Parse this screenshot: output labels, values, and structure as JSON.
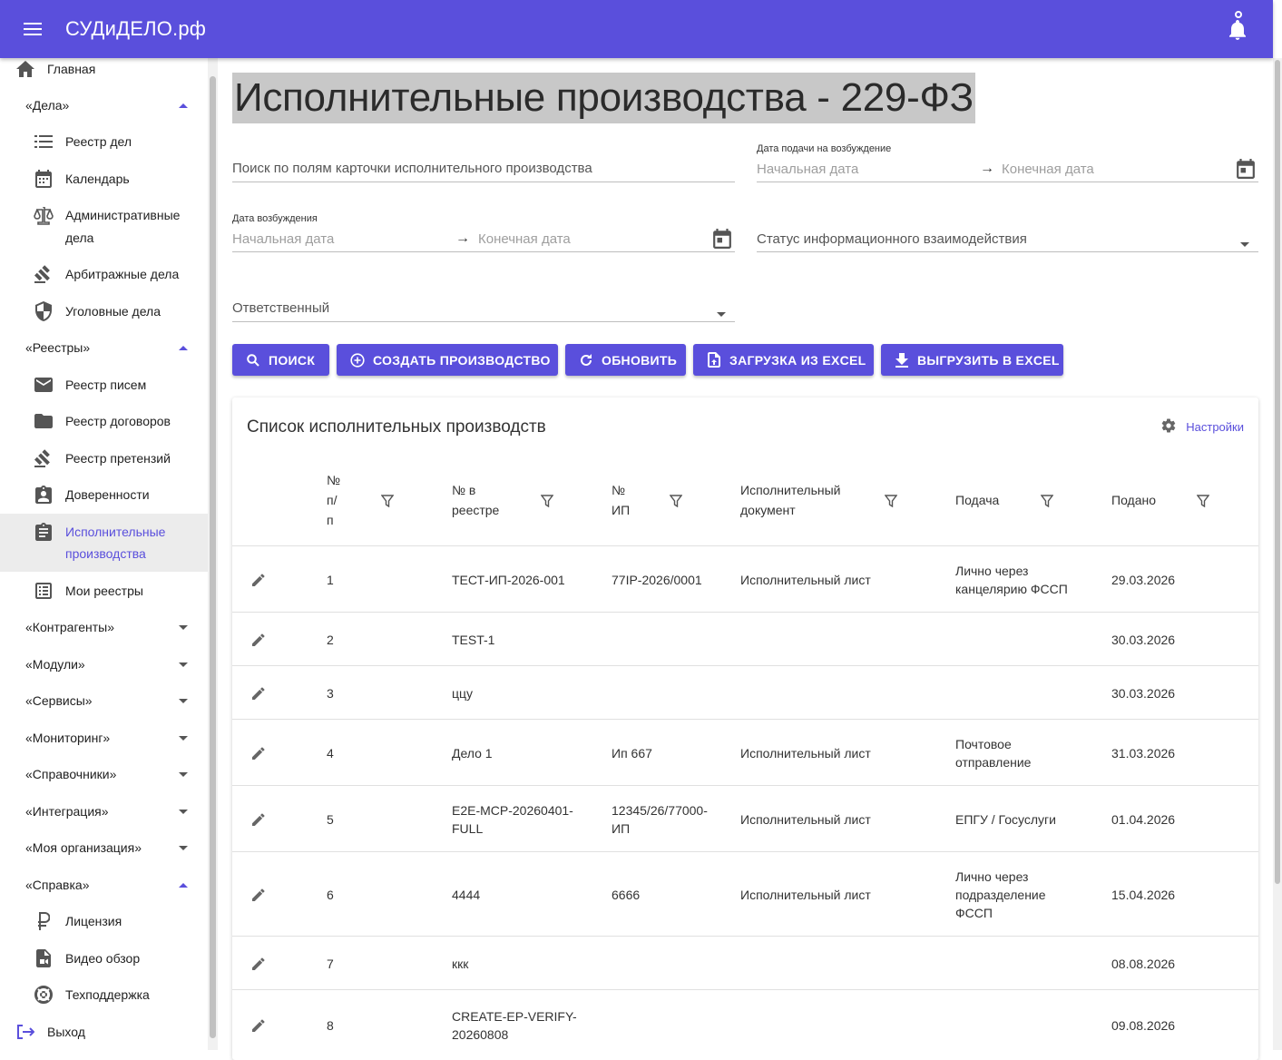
{
  "app": {
    "brand": "СУДиДЕЛО.рф"
  },
  "sidebar": {
    "home": "Главная",
    "cases_group": "«Дела»",
    "cases": [
      "Реестр дел",
      "Календарь",
      "Административные",
      "дела",
      "Арбитражные дела",
      "Уголовные дела"
    ],
    "registries_group": "«Реестры»",
    "registries": [
      "Реестр писем",
      "Реестр договоров",
      "Реестр претензий",
      "Доверенности",
      "Исполнительные",
      "производства",
      "Мои реестры"
    ],
    "groups": [
      "«Контрагенты»",
      "«Модули»",
      "«Сервисы»",
      "«Мониторинг»",
      "«Справочники»",
      "«Интеграция»",
      "«Моя организация»"
    ],
    "help_group": "«Справка»",
    "help": [
      "Лицензия",
      "Видео обзор",
      "Техподдержка"
    ],
    "logout": "Выход"
  },
  "page": {
    "title": "Исполнительные производства - 229-ФЗ"
  },
  "filters": {
    "search_placeholder": "Поиск по полям карточки исполнительного производства",
    "submit_date_label": "Дата подачи на возбуждение",
    "start_date": "Начальная дата",
    "end_date": "Конечная дата",
    "initiation_date_label": "Дата возбуждения",
    "status_placeholder": "Статус информационного взаимодействия",
    "responsible_placeholder": "Ответственный",
    "arrow": "→"
  },
  "buttons": {
    "search": "ПОИСК",
    "create": "СОЗДАТЬ ПРОИЗВОДСТВО",
    "refresh": "ОБНОВИТЬ",
    "import": "ЗАГРУЗКА ИЗ EXCEL",
    "export": "ВЫГРУЗИТЬ В EXCEL"
  },
  "table": {
    "title": "Список исполнительных производств",
    "settings": "Настройки",
    "headers": {
      "num": [
        "№",
        "п/",
        "п"
      ],
      "registry": [
        "№ в",
        "реестре"
      ],
      "ip": [
        "№",
        "ИП"
      ],
      "document": [
        "Исполнительный",
        "документ"
      ],
      "submission": "Подача",
      "submitted": "Подано"
    },
    "rows": [
      {
        "n": "1",
        "reg": [
          "ТЕСТ-ИП-2026-001"
        ],
        "ip": [
          "77IP-2026/0001"
        ],
        "doc": "Исполнительный лист",
        "sub": [
          "Лично через",
          "канцелярию ФССП"
        ],
        "date": "29.03.2026"
      },
      {
        "n": "2",
        "reg": [
          "TEST-1"
        ],
        "ip": [],
        "doc": "",
        "sub": [],
        "date": "30.03.2026"
      },
      {
        "n": "3",
        "reg": [
          "ццу"
        ],
        "ip": [],
        "doc": "",
        "sub": [],
        "date": "30.03.2026"
      },
      {
        "n": "4",
        "reg": [
          "Дело 1"
        ],
        "ip": [
          "Ип 667"
        ],
        "doc": "Исполнительный лист",
        "sub": [
          "Почтовое",
          "отправление"
        ],
        "date": "31.03.2026"
      },
      {
        "n": "5",
        "reg": [
          "E2E-MCP-20260401-",
          "FULL"
        ],
        "ip": [
          "12345/26/77000-",
          "ИП"
        ],
        "doc": "Исполнительный лист",
        "sub": [
          "ЕПГУ / Госуслуги"
        ],
        "date": "01.04.2026"
      },
      {
        "n": "6",
        "reg": [
          "4444"
        ],
        "ip": [
          "6666"
        ],
        "doc": "Исполнительный лист",
        "sub": [
          "Лично через",
          "подразделение",
          "ФССП"
        ],
        "date": "15.04.2026"
      },
      {
        "n": "7",
        "reg": [
          "ккк"
        ],
        "ip": [],
        "doc": "",
        "sub": [],
        "date": "08.08.2026"
      },
      {
        "n": "8",
        "reg": [
          "CREATE-EP-VERIFY-",
          "20260808"
        ],
        "ip": [],
        "doc": "",
        "sub": [],
        "date": "09.08.2026"
      }
    ]
  }
}
